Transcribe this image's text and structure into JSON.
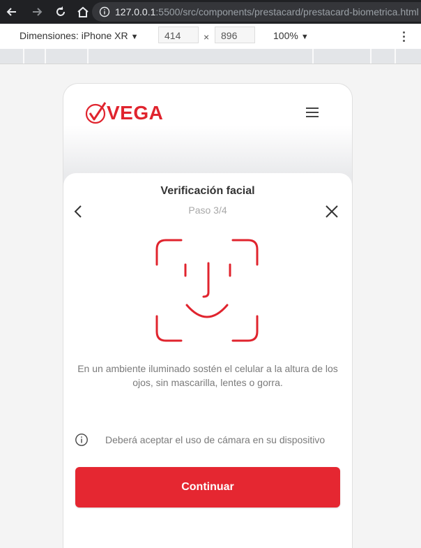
{
  "browser": {
    "url_host": "127.0.0.1",
    "url_path": ":5500/src/components/prestacard/prestacard-biometrica.html"
  },
  "device_toolbar": {
    "device_label": "Dimensiones: iPhone XR",
    "width": "414",
    "height": "896",
    "times": "×",
    "zoom": "100%"
  },
  "header": {
    "logo_text": "VEGA"
  },
  "card": {
    "title": "Verificación facial",
    "step": "Paso 3/4",
    "description": "En un ambiente iluminado sostén el celular a la altura de los ojos, sin mascarilla, lentes o gorra.",
    "notice": "Deberá aceptar el uso de cámara en su dispositivo",
    "continue_label": "Continuar"
  },
  "colors": {
    "brand_red": "#e52731",
    "browser_dark": "#202124"
  },
  "icons": [
    "back-arrow-icon",
    "forward-arrow-icon",
    "reload-icon",
    "home-icon",
    "info-icon",
    "chevron-left-icon",
    "close-icon",
    "face-id-icon",
    "hamburger-menu-icon"
  ]
}
